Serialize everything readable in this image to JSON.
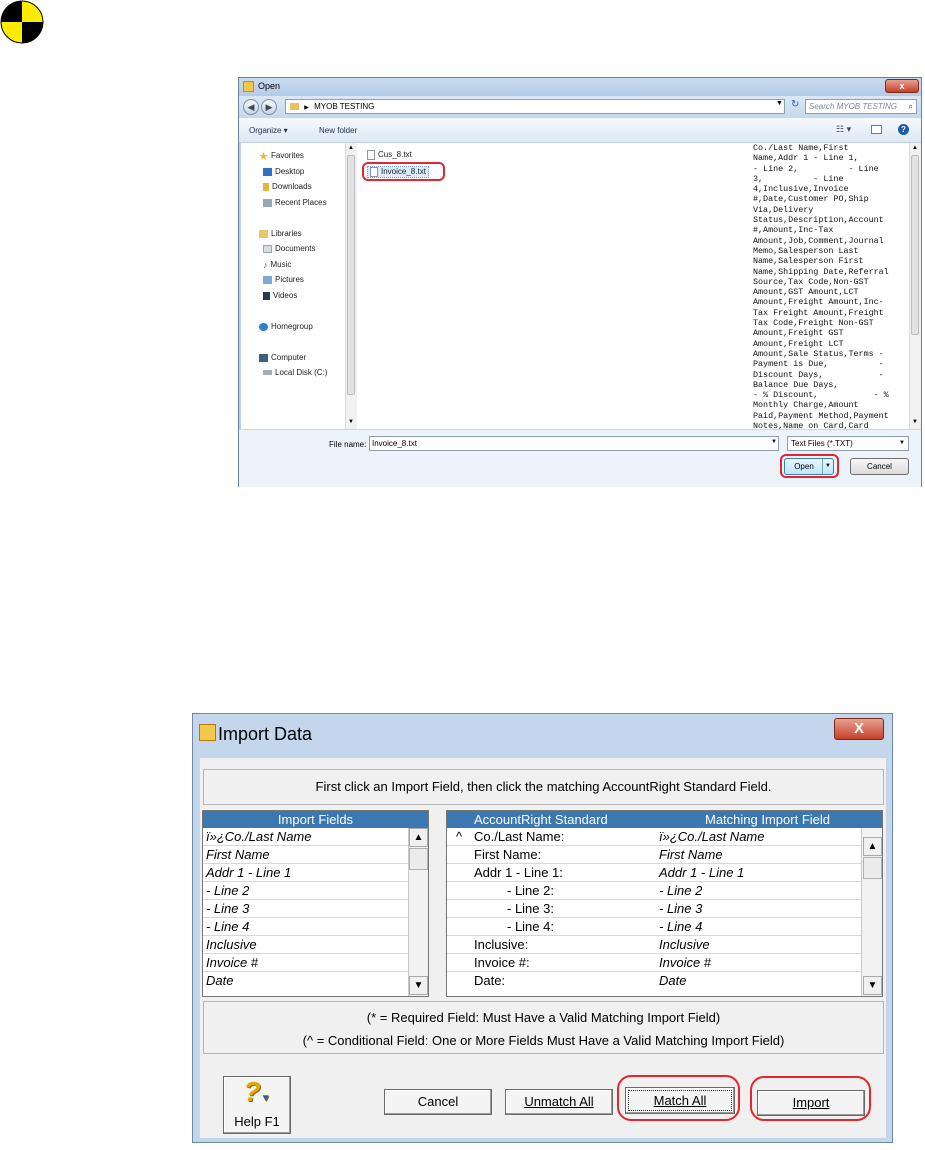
{
  "open_dialog": {
    "title": "Open",
    "address_path": "MYOB TESTING",
    "search_placeholder": "Search MYOB TESTING",
    "toolbar": {
      "organize": "Organize ▾",
      "new_folder": "New folder"
    },
    "nav": {
      "favorites": "Favorites",
      "desktop": "Desktop",
      "downloads": "Downloads",
      "recent_places": "Recent Places",
      "libraries": "Libraries",
      "documents": "Documents",
      "music": "Music",
      "pictures": "Pictures",
      "videos": "Videos",
      "homegroup": "Homegroup",
      "computer": "Computer",
      "local_disk": "Local Disk (C:)"
    },
    "files": [
      "Cus_8.txt",
      "Invoice_8.txt"
    ],
    "preview_text": "Co./Last Name,First\nName,Addr 1 - Line 1,\n- Line 2,          - Line\n3,          - Line\n4,Inclusive,Invoice\n#,Date,Customer PO,Ship\nVia,Delivery\nStatus,Description,Account\n#,Amount,Inc-Tax\nAmount,Job,Comment,Journal\nMemo,Salesperson Last\nName,Salesperson First\nName,Shipping Date,Referral\nSource,Tax Code,Non-GST\nAmount,GST Amount,LCT\nAmount,Freight Amount,Inc-\nTax Freight Amount,Freight\nTax Code,Freight Non-GST\nAmount,Freight GST\nAmount,Freight LCT\nAmount,Sale Status,Terms -\nPayment is Due,          -\nDiscount Days,           -\nBalance Due Days,\n- % Discount,           - %\nMonthly Charge,Amount\nPaid,Payment Method,Payment\nNotes,Name on Card,Card\nNumber,Expiry",
    "file_name_label": "File name:",
    "file_name_value": "Invoice_8.txt",
    "file_type": "Text Files (*.TXT)",
    "open_label": "Open",
    "cancel_label": "Cancel"
  },
  "import_dialog": {
    "title": "Import Data",
    "instruction": "First click an Import Field, then click the matching AccountRight Standard Field.",
    "import_fields_header": "Import Fields",
    "import_fields": [
      "ï»¿Co./Last Name",
      "First Name",
      "Addr 1 - Line 1",
      "- Line 2",
      "- Line 3",
      "- Line 4",
      "Inclusive",
      "Invoice #",
      "Date"
    ],
    "standard_header": "AccountRight Standard",
    "matching_header": "Matching Import Field",
    "mapping_rows": [
      {
        "marker": "^",
        "standard": "Co./Last Name:",
        "matching": "ï»¿Co./Last Name"
      },
      {
        "marker": "",
        "standard": "First Name:",
        "matching": "First Name"
      },
      {
        "marker": "",
        "standard": "Addr 1 - Line 1:",
        "matching": "Addr 1 - Line 1"
      },
      {
        "marker": "",
        "standard": "- Line 2:",
        "matching": "- Line 2"
      },
      {
        "marker": "",
        "standard": "- Line 3:",
        "matching": "- Line 3"
      },
      {
        "marker": "",
        "standard": "- Line 4:",
        "matching": "- Line 4"
      },
      {
        "marker": "",
        "standard": "Inclusive:",
        "matching": "Inclusive"
      },
      {
        "marker": "",
        "standard": "Invoice #:",
        "matching": "Invoice #"
      },
      {
        "marker": "",
        "standard": "Date:",
        "matching": "Date"
      }
    ],
    "required_note": "(* = Required Field:  Must Have a Valid Matching Import Field)",
    "conditional_note": "(^ = Conditional Field:  One or More Fields Must Have a Valid Matching Import Field)",
    "help_label": "Help F1",
    "cancel_label": "Cancel",
    "unmatch_all_label": "Unmatch All",
    "match_all_label": "Match All",
    "import_label": "Import"
  }
}
